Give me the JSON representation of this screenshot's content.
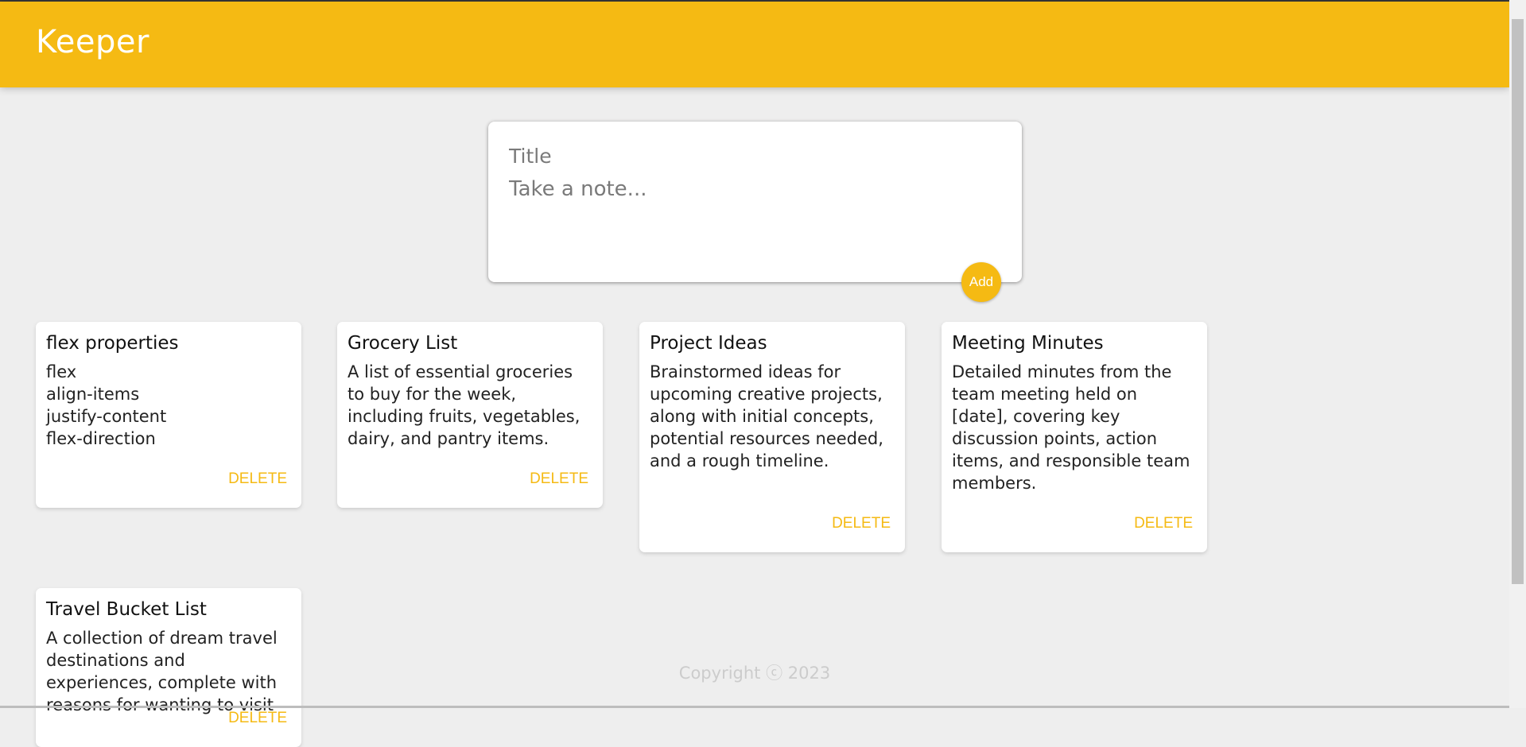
{
  "app": {
    "title": "Keeper"
  },
  "create_note": {
    "title_placeholder": "Title",
    "content_placeholder": "Take a note...",
    "add_label": "Add"
  },
  "notes": [
    {
      "title": "flex properties",
      "content": "flex\nalign-items\njustify-content\nflex-direction",
      "delete_label": "DELETE"
    },
    {
      "title": "Grocery List",
      "content": "A list of essential groceries to buy for the week, including fruits, vegetables, dairy, and pantry items.",
      "delete_label": "DELETE"
    },
    {
      "title": "Project Ideas",
      "content": "Brainstormed ideas for upcoming creative projects, along with initial concepts, potential resources needed, and a rough timeline.",
      "delete_label": "DELETE"
    },
    {
      "title": "Meeting Minutes",
      "content": "Detailed minutes from the team meeting held on [date], covering key discussion points, action items, and responsible team members.",
      "delete_label": "DELETE"
    },
    {
      "title": "Travel Bucket List",
      "content": " A collection of dream travel destinations and experiences, complete with reasons for wanting to visit",
      "delete_label": "DELETE"
    }
  ],
  "footer": {
    "text": "Copyright ⓒ 2023"
  },
  "colors": {
    "accent": "#f5ba13",
    "background": "#eeeeee",
    "card": "#ffffff",
    "footer_text": "#cccccc"
  }
}
